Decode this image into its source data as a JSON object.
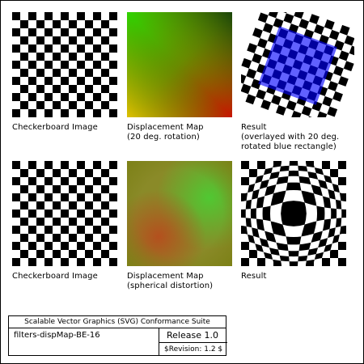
{
  "captions": {
    "row1_col1": "Checkerboard Image",
    "row1_col2": "Displacement Map\n(20 deg. rotation)",
    "row1_col3": "Result\n(overlayed with 20 deg.\nrotated blue rectangle)",
    "row2_col1": "Checkerboard Image",
    "row2_col2": "Displacement Map\n(spherical distortion)",
    "row2_col3": "Result"
  },
  "legend": {
    "suite_title": "Scalable Vector Graphics (SVG) Conformance Suite",
    "test_name": "filters-dispMap-BE-16",
    "release": "Release 1.0",
    "revision": "$Revision: 1.2 $"
  },
  "colors": {
    "checker_dark": "#000000",
    "checker_light": "#ffffff",
    "overlay_blue": "#0000ff",
    "border": "#000000"
  }
}
